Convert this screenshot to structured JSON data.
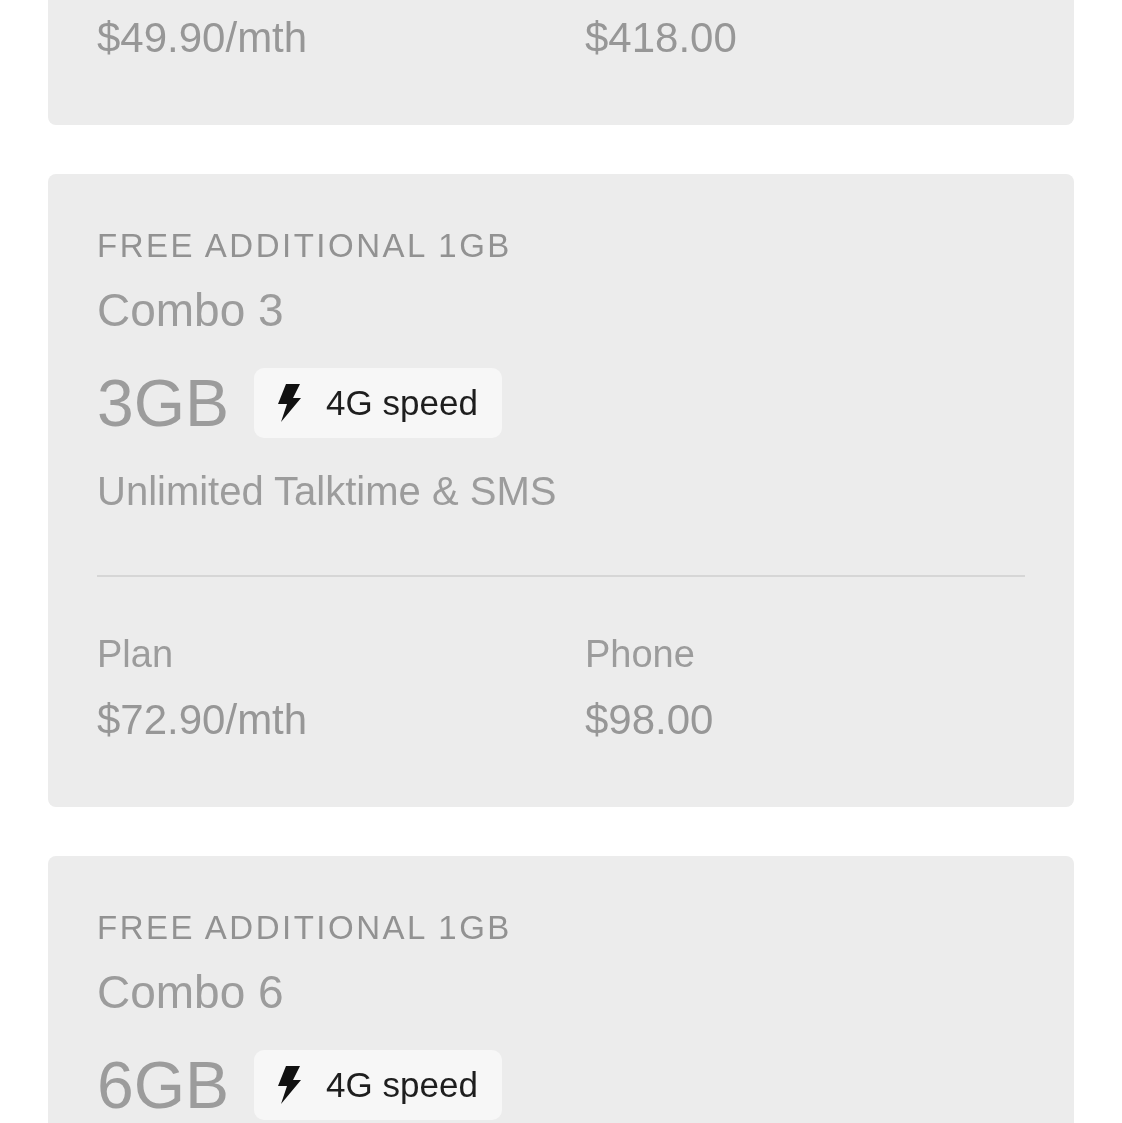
{
  "plans": [
    {
      "pricing": [
        {
          "amount": "$49.90/mth"
        },
        {
          "amount": "$418.00"
        }
      ]
    },
    {
      "promo": "FREE ADDITIONAL 1GB",
      "name": "Combo 3",
      "data": "3GB",
      "badge": "4G speed",
      "allowance": "Unlimited Talktime & SMS",
      "pricing": [
        {
          "label": "Plan",
          "amount": "$72.90/mth"
        },
        {
          "label": "Phone",
          "amount": "$98.00"
        }
      ]
    },
    {
      "promo": "FREE ADDITIONAL 1GB",
      "name": "Combo 6",
      "data": "6GB",
      "badge": "4G speed"
    }
  ]
}
